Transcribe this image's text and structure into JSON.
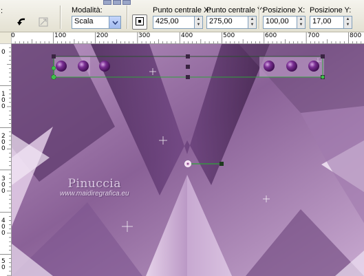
{
  "toolbar": {
    "mode_label": "Modalità:",
    "mode_value": "Scala",
    "center_x_label": "Punto centrale X:",
    "center_x_value": "425,00",
    "center_y_label": "Punto centrale Y:",
    "center_y_value": "275,00",
    "pos_x_label": "Posizione X:",
    "pos_x_value": "100,00",
    "pos_y_label": "Posizione Y:",
    "pos_y_value": "17,00",
    "truncated_label": ":"
  },
  "ruler": {
    "h_labels": [
      "0",
      "100",
      "200",
      "300",
      "400",
      "500",
      "600",
      "700",
      "800"
    ],
    "v_labels": [
      "0",
      "1 0 0",
      "2 0 0",
      "3 0 0",
      "4 0 0",
      "5 0"
    ]
  },
  "watermark": {
    "name": "Pinuccia",
    "url": "www.maidiregrafica.eu"
  },
  "colors": {
    "accent_purple": "#6b3a7d",
    "handle_green": "#2fa33a"
  }
}
